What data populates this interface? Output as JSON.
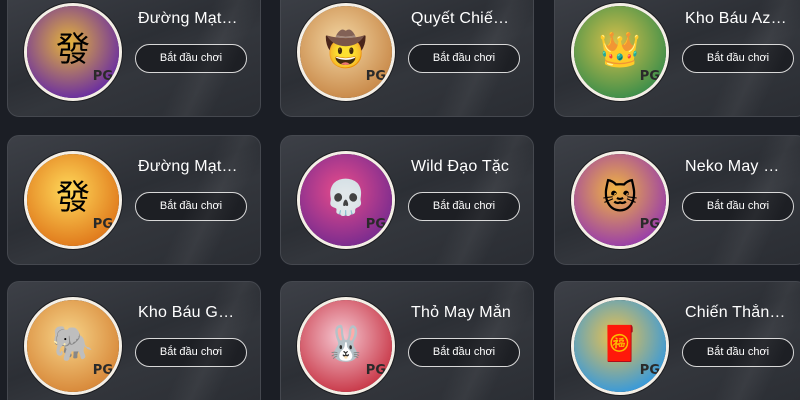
{
  "games": [
    {
      "title": "Đường Mạt…",
      "button": "Bắt đầu chơi",
      "icon": "mahjong-tile-icon",
      "glyph": "發",
      "brand": "PG",
      "colors": [
        "#6b2fa0",
        "#e6b53a"
      ]
    },
    {
      "title": "Quyết Chiế…",
      "button": "Bắt đầu chơi",
      "icon": "cowgirl-gunslinger-icon",
      "glyph": "🤠",
      "brand": "PG",
      "colors": [
        "#c98a4a",
        "#f3d7a4"
      ]
    },
    {
      "title": "Kho Báu Az…",
      "button": "Bắt đầu chơi",
      "icon": "aztec-princess-icon",
      "glyph": "👑",
      "brand": "PG",
      "colors": [
        "#3f8f4a",
        "#d8c04a"
      ]
    },
    {
      "title": "Đường Mạt…",
      "button": "Bắt đầu chơi",
      "icon": "mahjong-tile-icon",
      "glyph": "發",
      "brand": "PG",
      "colors": [
        "#e07a1c",
        "#ffd95a"
      ]
    },
    {
      "title": "Wild Đạo Tặc",
      "button": "Bắt đầu chơi",
      "icon": "skeleton-bandit-icon",
      "glyph": "💀",
      "brand": "PG",
      "colors": [
        "#7b2c8f",
        "#e94c8b"
      ]
    },
    {
      "title": "Neko May …",
      "button": "Bắt đầu chơi",
      "icon": "lucky-cat-icon",
      "glyph": "🐱",
      "brand": "PG",
      "colors": [
        "#9a3fa8",
        "#f2b640"
      ]
    },
    {
      "title": "Kho Báu G…",
      "button": "Bắt đầu chơi",
      "icon": "ganesha-icon",
      "glyph": "🐘",
      "brand": "PG",
      "colors": [
        "#d8893a",
        "#f7d58a"
      ]
    },
    {
      "title": "Thỏ May Mắn",
      "button": "Bắt đầu chơi",
      "icon": "lucky-rabbit-icon",
      "glyph": "🐰",
      "brand": "PG",
      "colors": [
        "#c93a4a",
        "#f6c8d2"
      ]
    },
    {
      "title": "Chiến Thắn…",
      "button": "Bắt đầu chơi",
      "icon": "fortune-god-icon",
      "glyph": "🧧",
      "brand": "PG",
      "colors": [
        "#3a9ad9",
        "#f0c24a"
      ]
    }
  ]
}
